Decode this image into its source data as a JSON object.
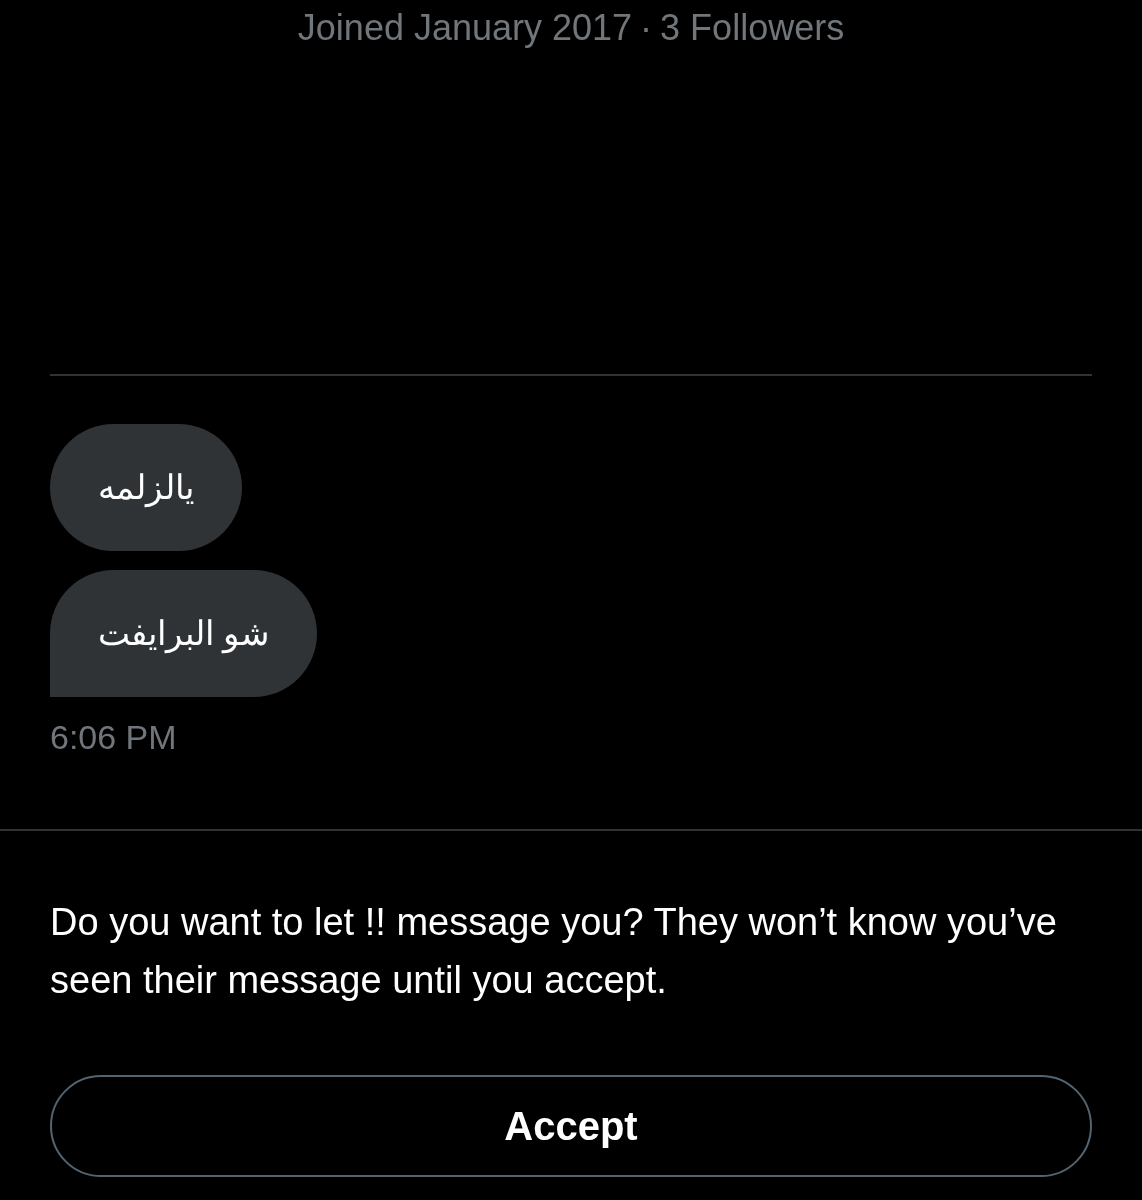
{
  "profile": {
    "joined": "Joined January 2017",
    "separator": "·",
    "followers": "3 Followers"
  },
  "messages": [
    {
      "text": "يالزلمه"
    },
    {
      "text": "شو البرايفت"
    }
  ],
  "timestamp": "6:06 PM",
  "request": {
    "prompt": "Do you want to let !! message you? They won’t know you’ve seen their message until you accept.",
    "button": "Accept"
  }
}
